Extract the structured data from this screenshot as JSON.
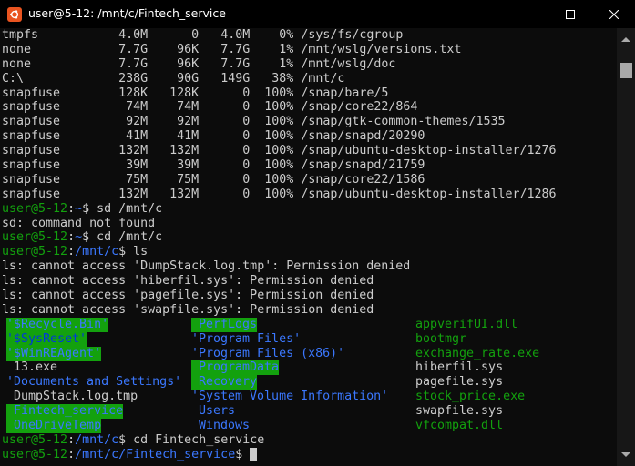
{
  "window": {
    "title": "user@5-12: /mnt/c/Fintech_service",
    "icon": "ubuntu-icon"
  },
  "df_rows": [
    [
      "tmpfs",
      "4.0M",
      "0",
      "4.0M",
      "0%",
      "/sys/fs/cgroup"
    ],
    [
      "none",
      "7.7G",
      "96K",
      "7.7G",
      "1%",
      "/mnt/wslg/versions.txt"
    ],
    [
      "none",
      "7.7G",
      "96K",
      "7.7G",
      "1%",
      "/mnt/wslg/doc"
    ],
    [
      "C:\\",
      "238G",
      "90G",
      "149G",
      "38%",
      "/mnt/c"
    ],
    [
      "snapfuse",
      "128K",
      "128K",
      "0",
      "100%",
      "/snap/bare/5"
    ],
    [
      "snapfuse",
      "74M",
      "74M",
      "0",
      "100%",
      "/snap/core22/864"
    ],
    [
      "snapfuse",
      "92M",
      "92M",
      "0",
      "100%",
      "/snap/gtk-common-themes/1535"
    ],
    [
      "snapfuse",
      "41M",
      "41M",
      "0",
      "100%",
      "/snap/snapd/20290"
    ],
    [
      "snapfuse",
      "132M",
      "132M",
      "0",
      "100%",
      "/snap/ubuntu-desktop-installer/1276"
    ],
    [
      "snapfuse",
      "39M",
      "39M",
      "0",
      "100%",
      "/snap/snapd/21759"
    ],
    [
      "snapfuse",
      "75M",
      "75M",
      "0",
      "100%",
      "/snap/core22/1586"
    ],
    [
      "snapfuse",
      "132M",
      "132M",
      "0",
      "100%",
      "/snap/ubuntu-desktop-installer/1286"
    ]
  ],
  "session": {
    "user_host": "user@5-12",
    "prompt1_path": "~",
    "cmd1": "sd /mnt/c",
    "error1": "sd: command not found",
    "prompt2_path": "~",
    "cmd2": "cd /mnt/c",
    "prompt3_path": "/mnt/c",
    "cmd3": "ls",
    "ls_errors": [
      "ls: cannot access 'DumpStack.log.tmp': Permission denied",
      "ls: cannot access 'hiberfil.sys': Permission denied",
      "ls: cannot access 'pagefile.sys': Permission denied",
      "ls: cannot access 'swapfile.sys': Permission denied"
    ],
    "ls_rows": [
      [
        "'$Recycle.Bin'",
        " PerfLogs",
        " appverifUI.dll"
      ],
      [
        "'$SysReset'",
        "'Program Files'",
        " bootmgr"
      ],
      [
        "'$WinREAgent'",
        "'Program Files (x86)'",
        " exchange_rate.exe"
      ],
      [
        " 13.exe",
        " ProgramData",
        " hiberfil.sys"
      ],
      [
        "'Documents and Settings'",
        " Recovery",
        " pagefile.sys"
      ],
      [
        " DumpStack.log.tmp",
        "'System Volume Information'",
        " stock_price.exe"
      ],
      [
        " Fintech_service",
        " Users",
        " swapfile.sys"
      ],
      [
        " OneDriveTemp",
        " Windows",
        " vfcompat.dll"
      ]
    ],
    "prompt4_path": "/mnt/c",
    "cmd4": "cd Fintech_service",
    "prompt5_path": "/mnt/c/Fintech_service",
    "cmd5": ""
  },
  "colors": {
    "prompt_user": "#13a10e",
    "prompt_path": "#3b78ff",
    "dir_highlight_bg": "#13a10e",
    "executable": "#13a10e",
    "text": "#cccccc",
    "background": "#0c0c0c"
  }
}
